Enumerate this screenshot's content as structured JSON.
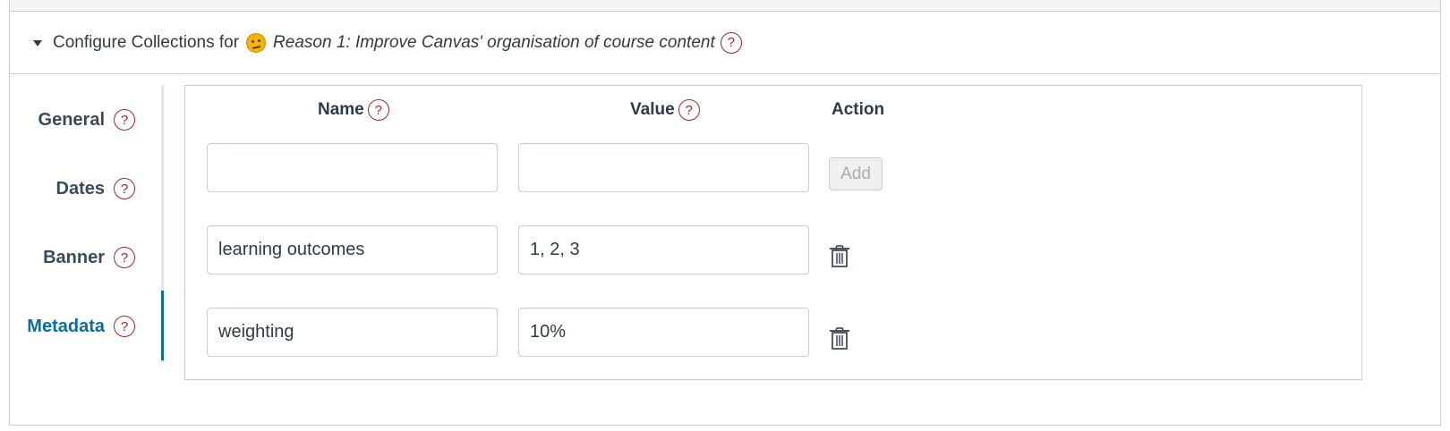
{
  "header": {
    "prefix": "Configure Collections for",
    "title": "Reason 1: Improve Canvas' organisation of course content",
    "help_glyph": "?"
  },
  "side_nav": {
    "items": [
      {
        "label": "General",
        "active": false
      },
      {
        "label": "Dates",
        "active": false
      },
      {
        "label": "Banner",
        "active": false
      },
      {
        "label": "Metadata",
        "active": true
      }
    ]
  },
  "metadata": {
    "columns": {
      "name": "Name",
      "value": "Value",
      "action": "Action"
    },
    "new_row": {
      "name": "",
      "value": "",
      "add_label": "Add"
    },
    "rows": [
      {
        "name": "learning outcomes",
        "value": "1, 2, 3"
      },
      {
        "name": "weighting",
        "value": "10%"
      }
    ]
  },
  "colors": {
    "accent": "#0770a3",
    "help_icon": "#a0262a",
    "border": "#c7cdd1",
    "text": "#2d3b45"
  },
  "icons": {
    "toggle": "caret-down-icon",
    "emoji": "thinking-face-icon",
    "help": "help-circle-icon",
    "delete": "trash-icon"
  }
}
